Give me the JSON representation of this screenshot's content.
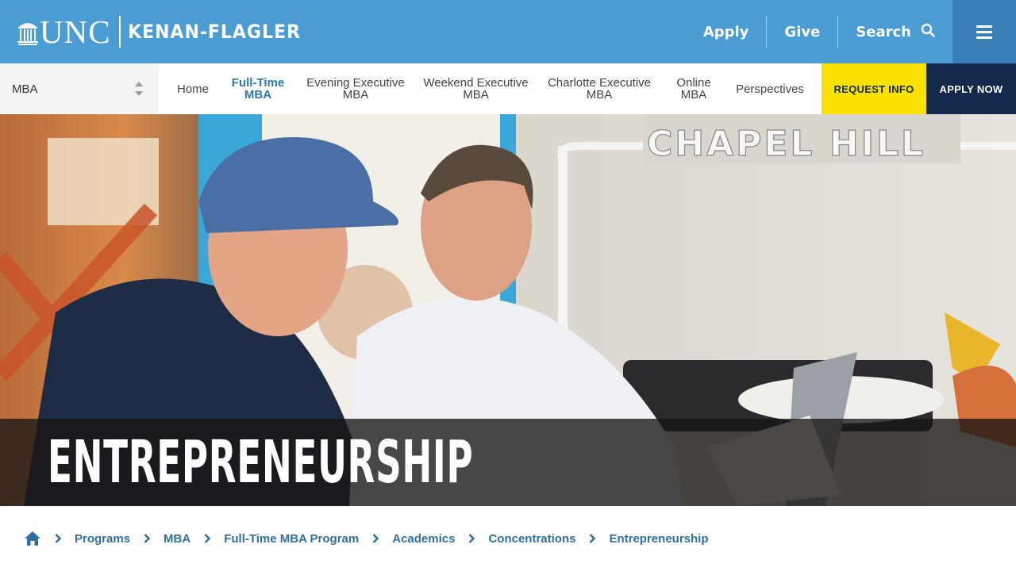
{
  "header": {
    "logo_unc": "UNC",
    "logo_school": "KENAN-FLAGLER",
    "links": {
      "apply": "Apply",
      "give": "Give",
      "search": "Search"
    }
  },
  "subnav": {
    "program_select": "MBA",
    "items": [
      {
        "lines": [
          "Home"
        ],
        "active": false
      },
      {
        "lines": [
          "Full-Time",
          "MBA"
        ],
        "active": true
      },
      {
        "lines": [
          "Evening Executive",
          "MBA"
        ],
        "active": false
      },
      {
        "lines": [
          "Weekend Executive",
          "MBA"
        ],
        "active": false
      },
      {
        "lines": [
          "Charlotte Executive",
          "MBA"
        ],
        "active": false
      },
      {
        "lines": [
          "Online",
          "MBA"
        ],
        "active": false
      },
      {
        "lines": [
          "Perspectives"
        ],
        "active": false
      }
    ],
    "request_info": "REQUEST INFO",
    "apply_now": "APPLY NOW"
  },
  "hero": {
    "title": "ENTREPRENEURSHIP",
    "wall_sign": "CHAPEL HILL"
  },
  "breadcrumb": [
    "Programs",
    "MBA",
    "Full-Time MBA Program",
    "Academics",
    "Concentrations",
    "Entrepreneurship"
  ],
  "colors": {
    "carolina_blue": "#4b9cd3",
    "navy": "#13294b",
    "yellow": "#fbe100",
    "link_blue": "#2f6fa3"
  }
}
